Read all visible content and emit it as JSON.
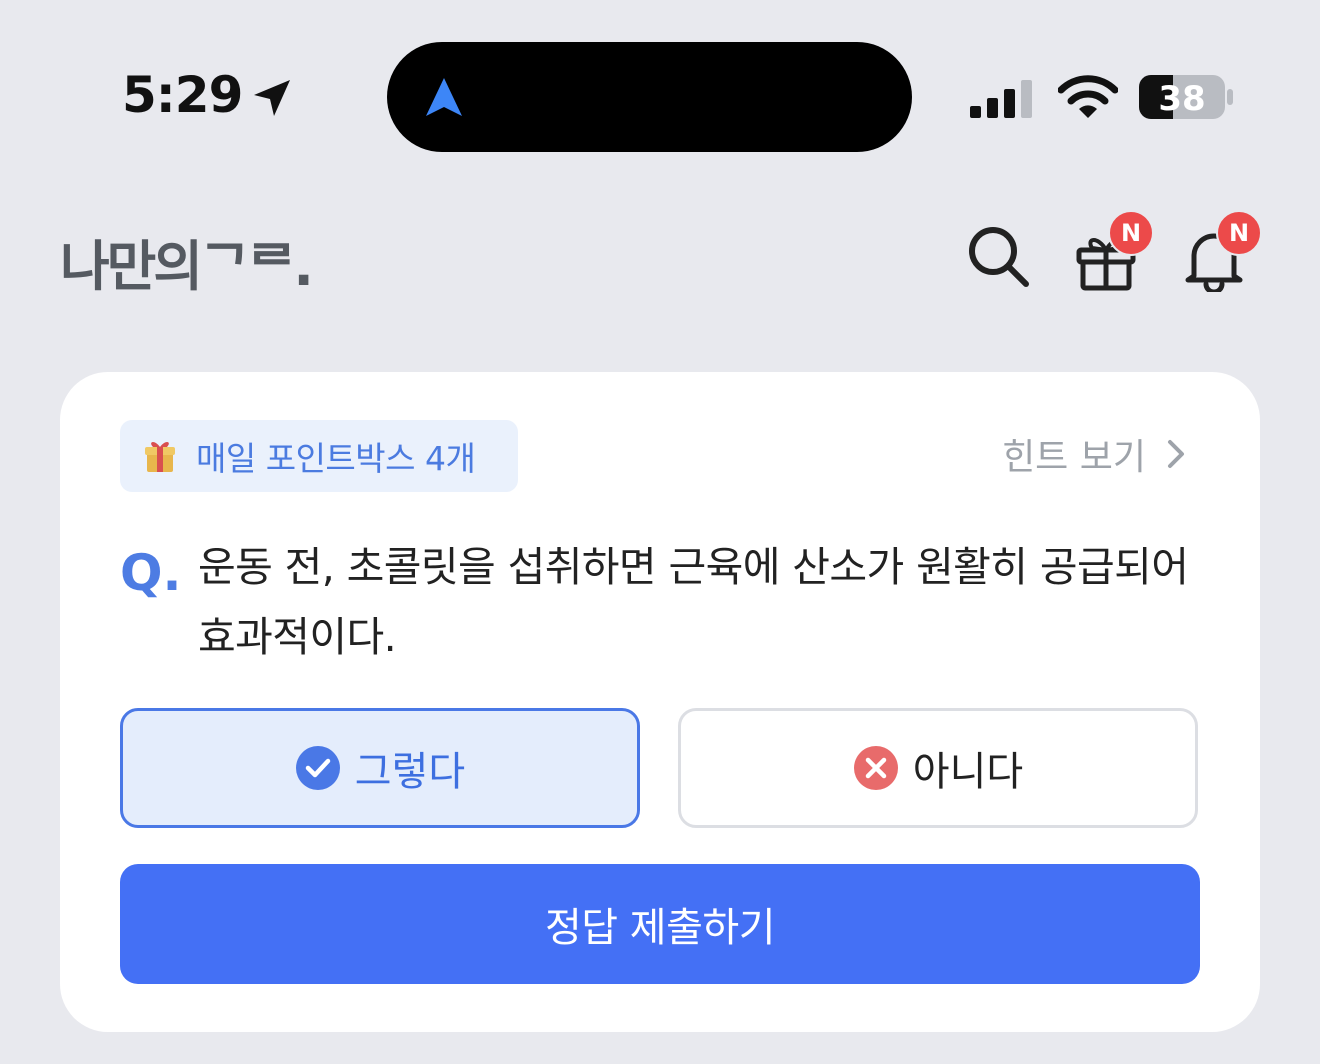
{
  "status_bar": {
    "time": "5:29",
    "battery": "38",
    "icons": [
      "location-arrow-icon",
      "navigation-icon",
      "signal-icon",
      "wifi-icon",
      "battery-icon"
    ]
  },
  "header": {
    "logo": "나만의ᄀᄅ.",
    "badges": {
      "gift": "N",
      "bell": "N"
    },
    "icons": [
      "search-icon",
      "gift-icon",
      "bell-icon"
    ]
  },
  "quiz": {
    "points_chip": "매일 포인트박스 4개",
    "hint_label": "힌트 보기",
    "q_label": "Q.",
    "question": "운동 전, 초콜릿을 섭취하면 근육에 산소가 원활히 공급되어 효과적이다.",
    "answers": [
      {
        "label": "그렇다",
        "selected": true
      },
      {
        "label": "아니다",
        "selected": false
      }
    ],
    "submit_label": "정답 제출하기"
  },
  "colors": {
    "background": "#e8e9ee",
    "accent": "#4470f5",
    "badge": "#ec4a4a",
    "no_icon": "#e86b6b"
  }
}
